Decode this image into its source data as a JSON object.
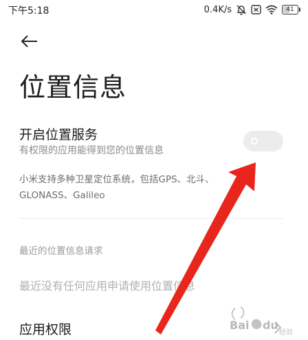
{
  "status_bar": {
    "time": "下午5:18",
    "network_speed": "0.4K/s",
    "battery_level": "41",
    "icons": [
      "mute-bell-icon",
      "sim-card-icon",
      "wifi-icon",
      "battery-icon"
    ]
  },
  "header": {
    "back_icon": "back-arrow-icon",
    "title": "位置信息"
  },
  "location_service": {
    "title": "开启位置服务",
    "description": "有权限的应用能得到您的位置信息",
    "enabled": false,
    "gnss_note": "小米支持多种卫星定位系统，包括GPS、北斗、GLONASS、Galileo"
  },
  "recent_requests": {
    "header": "最近的位置信息请求",
    "empty_message": "最近没有任何应用申请使用位置信息"
  },
  "app_permissions": {
    "label": "应用权限",
    "chevron_icon": "chevron-right-icon"
  },
  "colors": {
    "background": "#ffffff",
    "primary_text": "#1a1a1a",
    "secondary_text": "#8a8a8a",
    "toggle_off": "#ececec",
    "annotation_arrow": "#e8261c"
  }
}
